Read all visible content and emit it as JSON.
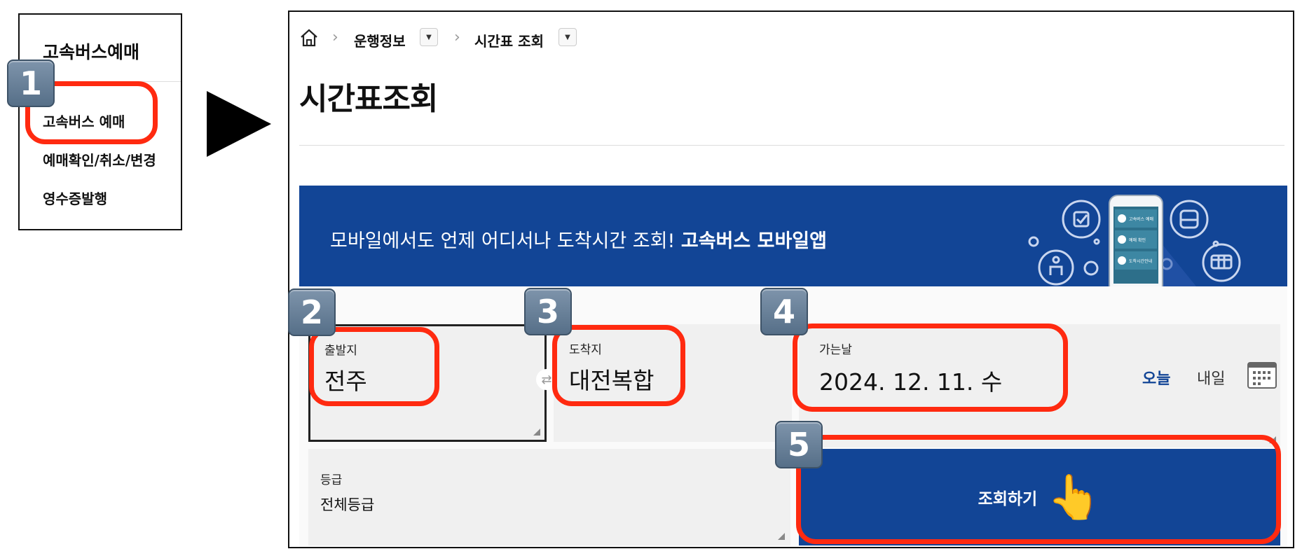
{
  "menu": {
    "title": "고속버스예매",
    "items": [
      "고속버스 예매",
      "예매확인/취소/변경",
      "영수증발행"
    ]
  },
  "steps": [
    "1",
    "2",
    "3",
    "4",
    "5"
  ],
  "breadcrumb": {
    "home_icon": "home-icon",
    "items": [
      "운행정보",
      "시간표 조회"
    ]
  },
  "page": {
    "title": "시간표조회"
  },
  "banner": {
    "text": "모바일에서도 언제 어디서나 도착시간 조회! ",
    "emphasis": "고속버스 모바일앱",
    "phone_menu": [
      "고속버스 예매",
      "예매 확인",
      "도착시간안내"
    ]
  },
  "form": {
    "departure": {
      "label": "출발지",
      "value": "전주"
    },
    "arrival": {
      "label": "도착지",
      "value": "대전복합"
    },
    "date": {
      "label": "가는날",
      "value": "2024. 12. 11. 수",
      "today": "오늘",
      "tomorrow": "내일"
    },
    "grade": {
      "label": "등급",
      "value": "전체등급"
    },
    "search_label": "조회하기"
  },
  "colors": {
    "brand": "#124596",
    "highlight": "#ff2a10",
    "today_text": "#124596"
  }
}
